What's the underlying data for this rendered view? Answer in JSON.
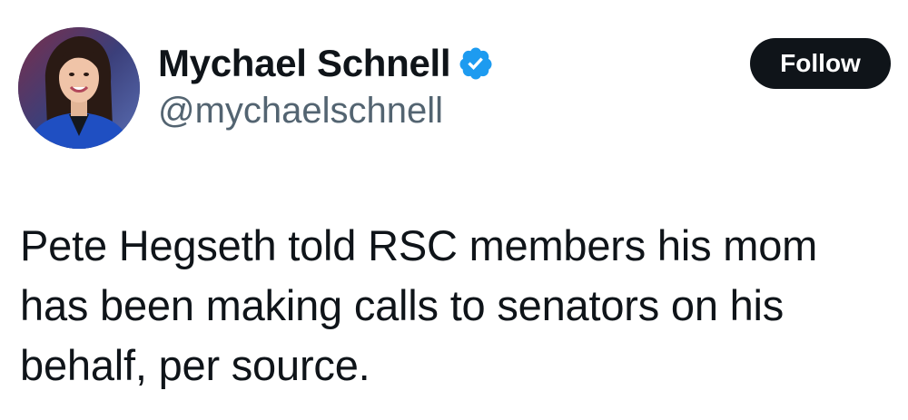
{
  "author": {
    "display_name": "Mychael Schnell",
    "handle": "@mychaelschnell",
    "verified_icon": "verified-badge-icon",
    "verified_color": "#1d9bf0"
  },
  "follow_button": {
    "label": "Follow"
  },
  "tweet": {
    "text": "Pete Hegseth told RSC members his mom has been making calls to senators on his behalf, per source."
  },
  "colors": {
    "text": "#0f1419",
    "secondary_text": "#536471",
    "button_bg": "#0f1419",
    "button_text": "#ffffff"
  }
}
